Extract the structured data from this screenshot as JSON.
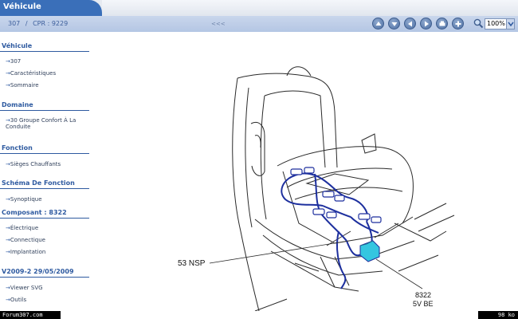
{
  "header": {
    "title": "Véhicule",
    "breadcrumb": [
      "307",
      "/",
      "CPR : 9229"
    ],
    "center_mark": "<<<",
    "zoom_value": "100%"
  },
  "toolbar": {
    "icons": [
      "up-arrow-icon",
      "down-arrow-icon",
      "left-arrow-icon",
      "right-arrow-icon",
      "print-icon",
      "plus-icon",
      "zoom-icon"
    ]
  },
  "sidebar": {
    "sections": [
      {
        "title": "Véhicule",
        "items": [
          "307",
          "Caractéristiques",
          "Sommaire"
        ]
      },
      {
        "title": "Domaine",
        "items": [
          "30 Groupe Confort À La Conduite"
        ]
      },
      {
        "title": "Fonction",
        "items": [
          "Sièges Chauffants"
        ]
      },
      {
        "title": "Schéma De Fonction",
        "items": [
          "Synoptique"
        ]
      },
      {
        "title": "Composant : 8322",
        "items": [
          "Électrique",
          "Connectique",
          "Implantation"
        ]
      },
      {
        "title": "V2009-2 29/05/2009",
        "items": [
          "Viewer SVG",
          "Outils"
        ]
      }
    ]
  },
  "drawing": {
    "labels": {
      "left": "53 NSP",
      "component_code": "8322",
      "component_sub": "5V BE"
    },
    "colors": {
      "harness": "#1d2f9e",
      "component": "#34c6e0",
      "line": "#2a2a2a"
    }
  },
  "footer": {
    "left": "Forum307.com",
    "right": "98 ko"
  }
}
